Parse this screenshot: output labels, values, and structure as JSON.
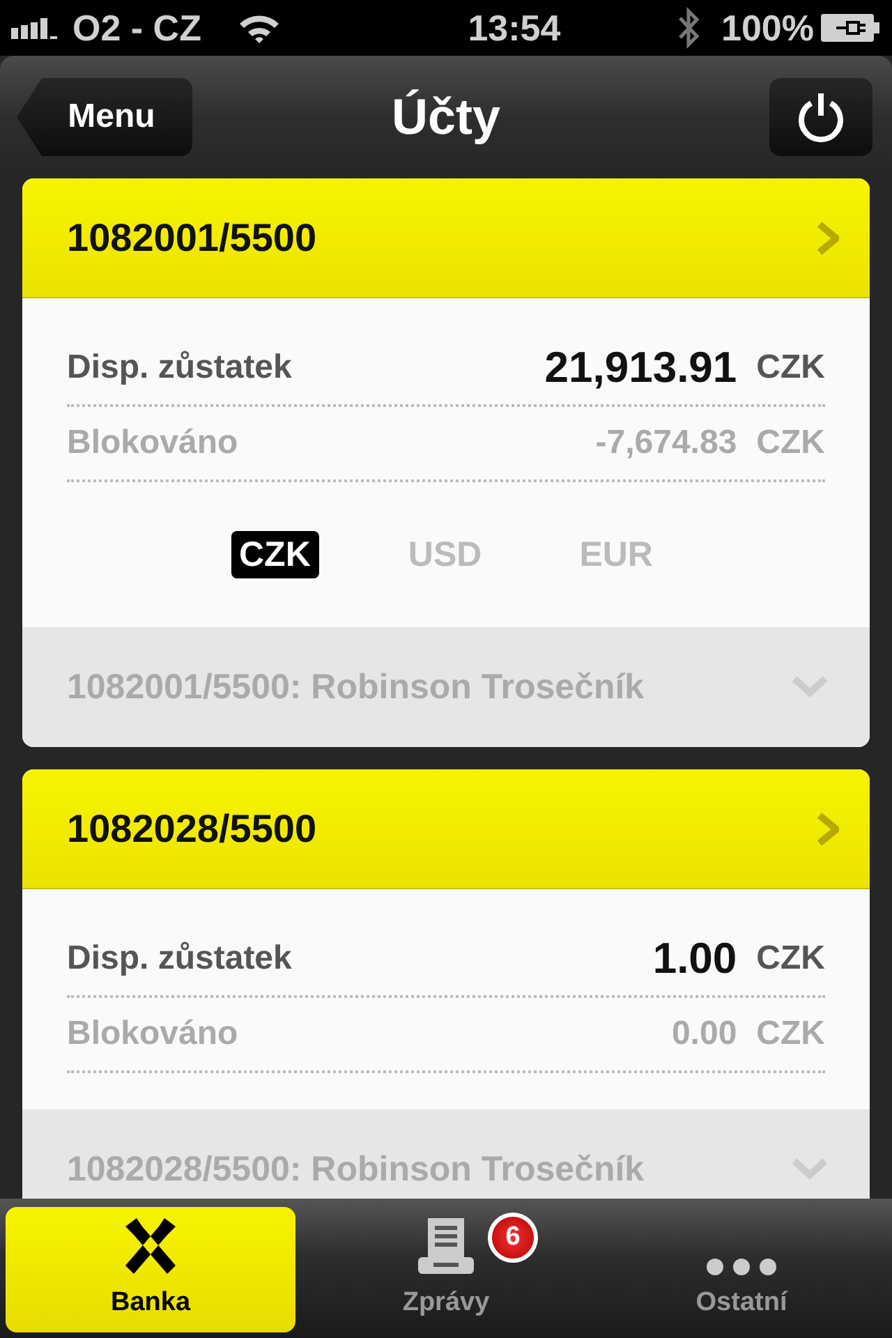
{
  "status_bar": {
    "carrier": "O2 - CZ",
    "time": "13:54",
    "battery": "100%"
  },
  "nav": {
    "back": "Menu",
    "title": "Účty"
  },
  "accounts": [
    {
      "number": "1082001/5500",
      "rows": [
        {
          "kind": "balance",
          "label": "Disp. zůstatek",
          "amount": "21,913.91",
          "currency": "CZK"
        },
        {
          "kind": "blocked",
          "label": "Blokováno",
          "amount": "-7,674.83",
          "currency": "CZK"
        }
      ],
      "currencies": [
        {
          "label": "CZK",
          "selected": true
        },
        {
          "label": "USD",
          "selected": false
        },
        {
          "label": "EUR",
          "selected": false
        }
      ],
      "footer": "1082001/5500: Robinson Trosečník"
    },
    {
      "number": "1082028/5500",
      "rows": [
        {
          "kind": "balance",
          "label": "Disp. zůstatek",
          "amount": "1.00",
          "currency": "CZK"
        },
        {
          "kind": "blocked",
          "label": "Blokováno",
          "amount": "0.00",
          "currency": "CZK"
        }
      ],
      "footer": "1082028/5500: Robinson Trosečník"
    }
  ],
  "tabs": [
    {
      "label": "Banka",
      "selected": true,
      "kind": "bank"
    },
    {
      "label": "Zprávy",
      "selected": false,
      "kind": "printer",
      "badge": "6"
    },
    {
      "label": "Ostatní",
      "selected": false,
      "kind": "more"
    }
  ]
}
